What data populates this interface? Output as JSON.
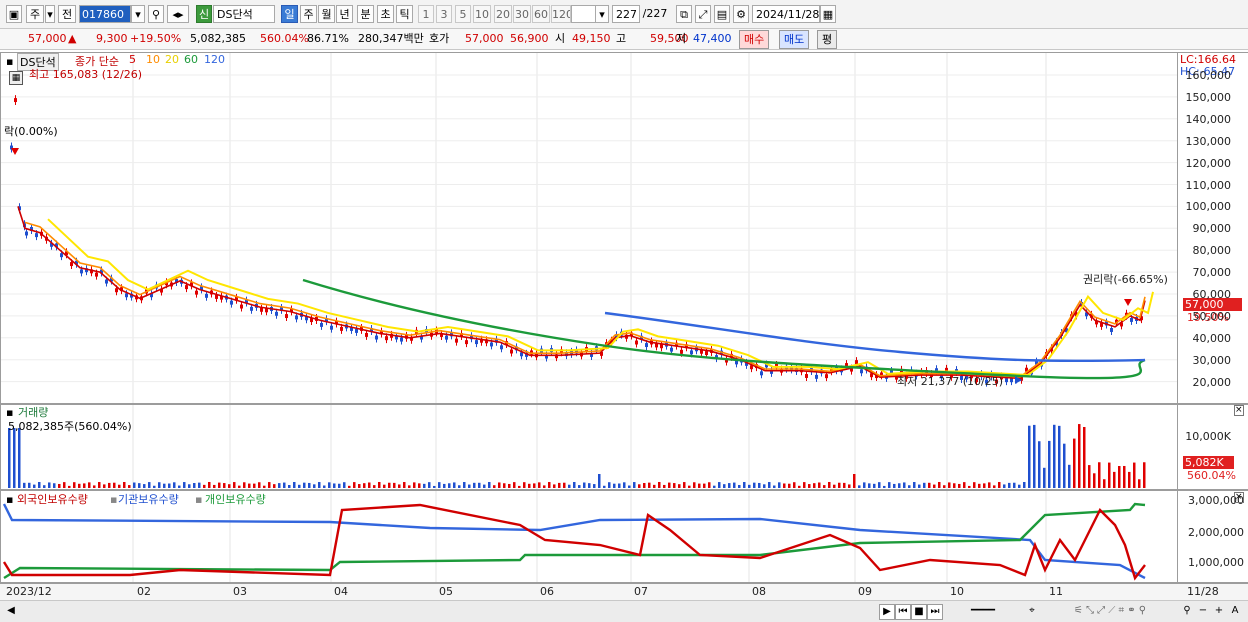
{
  "toolbar": {
    "market": "주",
    "prev": "전",
    "code": "017860",
    "shin": "신",
    "stock_name": "DS단석",
    "periods": [
      "일",
      "주",
      "월",
      "년",
      "분",
      "초",
      "틱"
    ],
    "selected_period": "일",
    "intervals": [
      "1",
      "3",
      "5",
      "10",
      "20",
      "30",
      "60",
      "120"
    ],
    "count": "227",
    "count_total": "/227",
    "date": "2024/11/28"
  },
  "info": {
    "price": "57,000",
    "change_arrow": "▲",
    "change": "9,300",
    "change_pct": "+19.50%",
    "volume": "5,082,385",
    "vol_ratio": "560.04%",
    "turnover": "86.71%",
    "amount": "280,347백만",
    "bid_label": "호가",
    "ask": "57,000",
    "bid": "56,900",
    "open_label": "시",
    "open": "49,150",
    "high_label": "고",
    "high": "59,500",
    "low_label": "저",
    "low": "47,400",
    "buy": "매수",
    "sell": "매도",
    "eval": "평"
  },
  "price_panel": {
    "name": "DS단석",
    "ma_label": "종가 단순",
    "ma_periods": [
      "5",
      "10",
      "20",
      "60",
      "120"
    ],
    "high_note": "최고 165,083 (12/26)",
    "low_note": "최저 21,377 (10/25)",
    "right_note": "권리락(-66.65%)",
    "left_note": "락(0.00%)",
    "lc": "LC:166.64",
    "hc": "HC:-65.47",
    "yticks": [
      "160,000",
      "150,000",
      "140,000",
      "130,000",
      "120,000",
      "110,000",
      "100,000",
      "90,000",
      "80,000",
      "70,000",
      "60,000",
      "50,000",
      "40,000",
      "30,000",
      "20,000"
    ],
    "last_price": "57,000",
    "last_pct": "19.50%"
  },
  "volume_panel": {
    "name": "거래량",
    "note": "5,082,385주(560.04%)",
    "ytick": "10,000K",
    "last": "5,082K",
    "last_pct": "560.04%"
  },
  "holdings_panel": {
    "series": [
      "외국인보유수량",
      "기관보유수량",
      "개인보유수량"
    ],
    "yticks": [
      "3,000,000",
      "2,000,000",
      "1,000,000"
    ]
  },
  "dates": [
    "2023/12",
    "02",
    "03",
    "04",
    "05",
    "06",
    "07",
    "08",
    "09",
    "10",
    "11",
    "11/28"
  ],
  "colors": {
    "up": "#e00000",
    "down": "#1f4fcf",
    "ma5": "#d00000",
    "ma10": "#ff8c00",
    "ma20": "#ffe600",
    "ma60": "#1c9a3a",
    "ma120": "#3366dd"
  },
  "chart_data": [
    {
      "type": "line",
      "title": "DS단석",
      "series": [
        {
          "name": "종가",
          "x": [
            "2023/12",
            "01",
            "02",
            "03",
            "04",
            "05",
            "06",
            "07",
            "08",
            "09",
            "10",
            "11",
            "11/28"
          ],
          "values": [
            120000,
            85000,
            60000,
            55000,
            42000,
            40000,
            32000,
            40000,
            30000,
            25000,
            22000,
            50000,
            57000
          ]
        }
      ],
      "ylim": [
        15000,
        170000
      ]
    },
    {
      "type": "bar",
      "title": "거래량",
      "series": [
        {
          "name": "거래량",
          "values": [
            5082
          ]
        }
      ],
      "ylabel": "K"
    }
  ]
}
